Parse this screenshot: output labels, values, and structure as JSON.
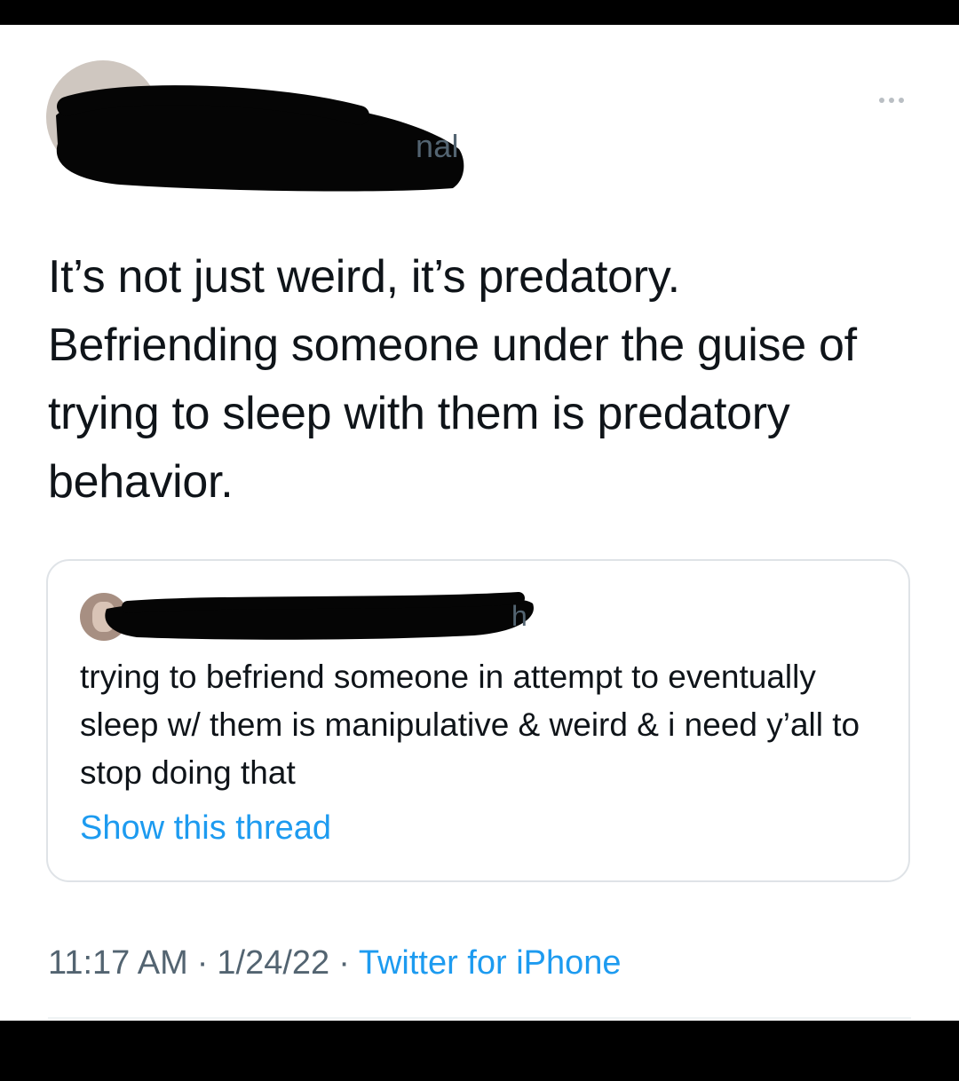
{
  "author": {
    "handle_visible_fragment": "nal"
  },
  "tweet": {
    "text": "It’s not just weird, it’s predatory. Befriending someone under the guise of trying to sleep with them is predatory behavior."
  },
  "quoted_tweet": {
    "name_visible_fragment": "h",
    "text": "trying to befriend someone in attempt to eventually sleep w/ them is manipulative & weird & i need y’all to stop doing that",
    "show_thread_label": "Show this thread"
  },
  "meta": {
    "time": "11:17 AM",
    "separator": "·",
    "date": "1/24/22",
    "source": "Twitter for iPhone"
  },
  "colors": {
    "link": "#1d9bf0",
    "text_primary": "#0f1419",
    "text_secondary": "#536471",
    "border": "#dfe3e7"
  },
  "icons": {
    "more": "more-horizontal-icon"
  }
}
